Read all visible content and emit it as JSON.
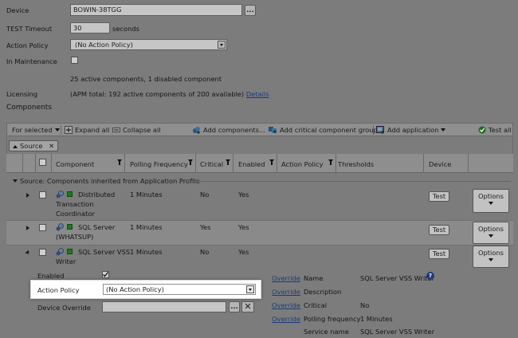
{
  "form": {
    "device_label": "Device",
    "device_value": "BOWIN-38TGG",
    "browse_label": "...",
    "timeout_label": "TEST Timeout",
    "timeout_value": "30",
    "timeout_unit": "seconds",
    "action_policy_label": "Action Policy",
    "action_policy_value": "(No Action Policy)",
    "maintenance_label": "In Maintenance",
    "components_summary": "25 active components, 1 disabled component",
    "licensing_label": "Licensing",
    "licensing_text": "(APM total: 192 active components of 200 available)",
    "licensing_link": "Details"
  },
  "section_title": "Components",
  "toolbar": {
    "for_selected": "For selected",
    "expand_all": "Expand all",
    "collapse_all": "Collapse all",
    "add_components": "Add components...",
    "add_critical_group": "Add critical component group",
    "add_application": "Add application",
    "test_all": "Test all"
  },
  "group_chip": {
    "label": "Source",
    "close": "✕"
  },
  "columns": {
    "component": "Component",
    "polling": "Polling Frequency",
    "critical": "Critical",
    "enabled": "Enabled",
    "action_policy": "Action Policy",
    "thresholds": "Thresholds",
    "device": "Device"
  },
  "group_header": "Source: Components inherited from Application Profile",
  "rows": [
    {
      "name_line1": "Distributed",
      "name_line2": "Transaction",
      "name_line3": "Coordinator",
      "polling": "1 Minutes",
      "critical": "No",
      "enabled": "Yes",
      "test": "Test",
      "options": "Options"
    },
    {
      "name_line1": "SQL Server",
      "name_line2": "(WHATSUP)",
      "polling": "1 Minutes",
      "critical": "Yes",
      "enabled": "Yes",
      "test": "Test",
      "options": "Options"
    },
    {
      "name_line1": "SQL Server VSS",
      "name_line2": "Writer",
      "polling": "1 Minutes",
      "critical": "No",
      "enabled": "Yes",
      "test": "Test",
      "options": "Options"
    }
  ],
  "detail": {
    "enabled_label": "Enabled",
    "action_policy_label": "Action Policy",
    "action_policy_value": "(No Action Policy)",
    "device_override_label": "Device Override",
    "browse_label": "...",
    "clear_label": "✕",
    "override": "Override",
    "props": [
      {
        "key": "Name",
        "value": "SQL Server VSS Writer",
        "override": true
      },
      {
        "key": "Description",
        "value": "",
        "override": true
      },
      {
        "key": "Critical",
        "value": "No",
        "override": true
      },
      {
        "key": "Polling frequency",
        "value": "1 Minutes",
        "override": true
      },
      {
        "key": "Service name",
        "value": "SQL Server VSS Writer",
        "override": false
      }
    ],
    "help": "?"
  },
  "colors": {
    "green": "#1c7a1c",
    "link": "#1b3b7a",
    "overlay": "#7c7c7c"
  }
}
